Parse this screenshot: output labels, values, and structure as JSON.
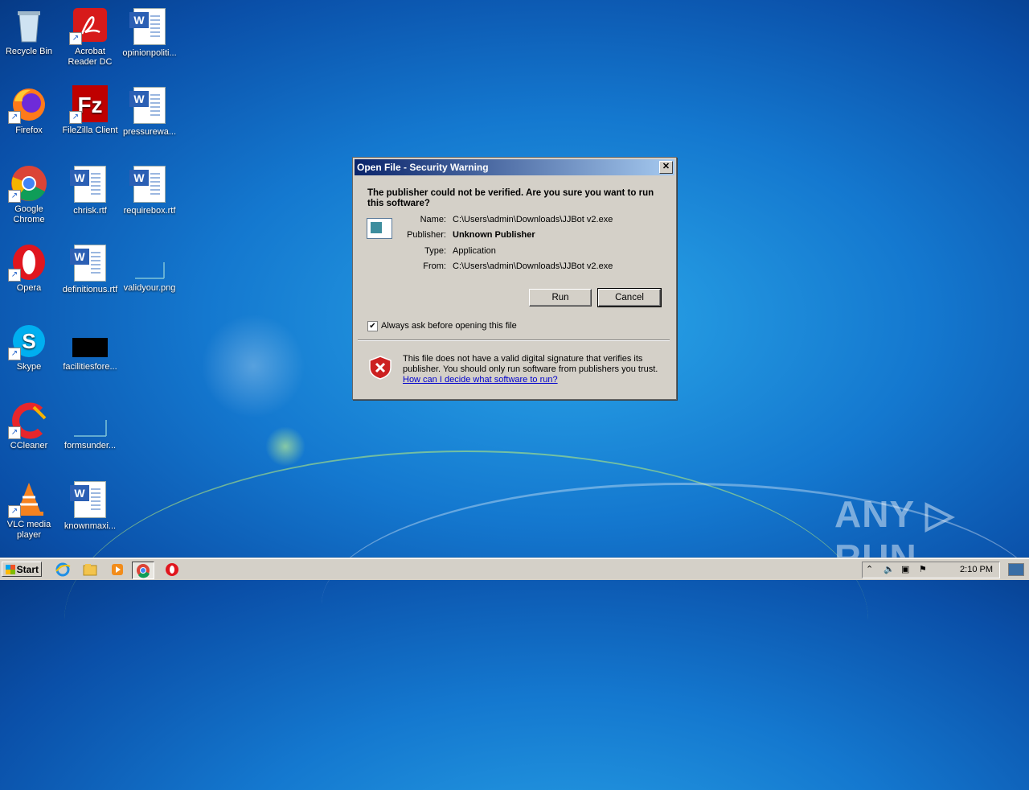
{
  "desktop": {
    "icons": [
      {
        "label": "Recycle Bin"
      },
      {
        "label": "Acrobat Reader DC"
      },
      {
        "label": "opinionpoliti..."
      },
      {
        "label": "Firefox"
      },
      {
        "label": "FileZilla Client"
      },
      {
        "label": "pressurewa..."
      },
      {
        "label": "Google Chrome"
      },
      {
        "label": "chrisk.rtf"
      },
      {
        "label": "requirebox.rtf"
      },
      {
        "label": "Opera"
      },
      {
        "label": "definitionus.rtf"
      },
      {
        "label": "validyour.png"
      },
      {
        "label": "Skype"
      },
      {
        "label": "facilitiesfore..."
      },
      {
        "label": "CCleaner"
      },
      {
        "label": "formsunder..."
      },
      {
        "label": "VLC media player"
      },
      {
        "label": "knownmaxi..."
      }
    ]
  },
  "dialog": {
    "title": "Open File - Security Warning",
    "close_glyph": "✕",
    "question": "The publisher could not be verified.  Are you sure you want to run this software?",
    "fields": [
      {
        "label": "Name:",
        "value": "C:\\Users\\admin\\Downloads\\JJBot v2.exe"
      },
      {
        "label": "Publisher:",
        "value": "Unknown Publisher"
      },
      {
        "label": "Type:",
        "value": "Application"
      },
      {
        "label": "From:",
        "value": "C:\\Users\\admin\\Downloads\\JJBot v2.exe"
      }
    ],
    "run_label": "Run",
    "cancel_label": "Cancel",
    "checkbox_label": "Always ask before opening this file",
    "checkbox_checked": true,
    "checkbox_glyph": "✔",
    "warning_text": "This file does not have a valid digital signature that verifies its publisher.  You should only run software from publishers you trust.",
    "help_link": "How can I decide what software to run?"
  },
  "taskbar": {
    "start_label": "Start",
    "clock": "2:10 PM"
  },
  "watermark": "ANY ▷ RUN",
  "colors": {
    "title_gradient_start": "#0a246a",
    "title_gradient_end": "#a6caf0",
    "dialog_face": "#d4d0c8",
    "warning_red": "#cc2020"
  }
}
